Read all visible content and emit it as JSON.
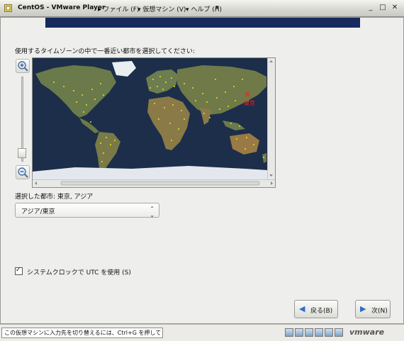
{
  "window": {
    "title": "CentOS - VMware Player",
    "menus": [
      "ファイル (F)",
      "仮想マシン (V)",
      "ヘルプ (H)"
    ]
  },
  "installer": {
    "prompt": "使用するタイムゾーンの中で一番近い都市を選択してください:",
    "map_marker_city": "東京",
    "selected_city_label": "選択した都市: 東京, アジア",
    "timezone_value": "アジア/東京",
    "utc_checked": true,
    "utc_label": "システムクロックで UTC を使用 (S)",
    "back_label": "戻る(B)",
    "next_label": "次(N)"
  },
  "status": {
    "message": "この仮想マシンに入力先を切り替えるには、Ctrl+G を押してください。",
    "brand": "vmware"
  },
  "colors": {
    "header_band": "#162a5e",
    "ocean": "#1c2e4a",
    "city_dot": "#e6e610",
    "marker": "#ff2020"
  }
}
